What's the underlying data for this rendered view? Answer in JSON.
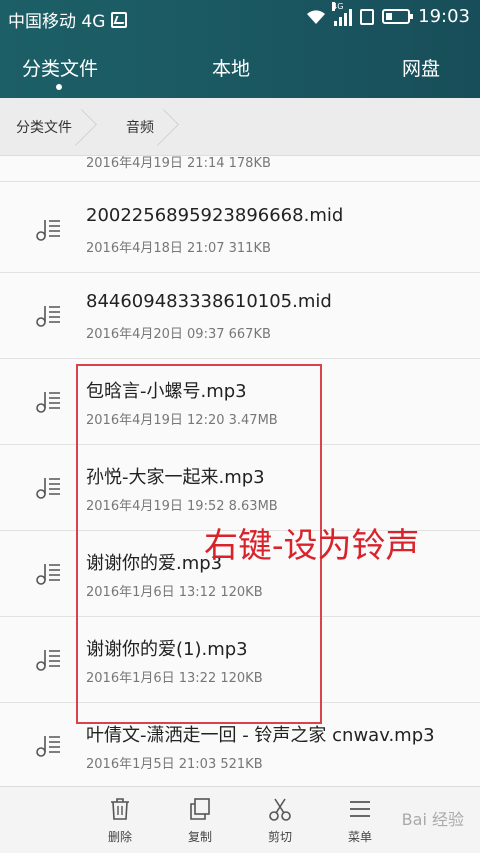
{
  "status": {
    "carrier": "中国移动 4G",
    "network_tag": "4G",
    "time": "19:03"
  },
  "tabs": [
    {
      "label": "分类文件",
      "active": true
    },
    {
      "label": "本地",
      "active": false
    },
    {
      "label": "网盘",
      "active": false
    }
  ],
  "breadcrumb": [
    "分类文件",
    "音频"
  ],
  "files": [
    {
      "name": "",
      "meta": "2016年4月19日 21:14 178KB"
    },
    {
      "name": "2002256895923896668.mid",
      "meta": "2016年4月18日 21:07 311KB"
    },
    {
      "name": "844609483338610105.mid",
      "meta": "2016年4月20日 09:37 667KB"
    },
    {
      "name": "包晗言-小螺号.mp3",
      "meta": "2016年4月19日 12:20 3.47MB"
    },
    {
      "name": "孙悦-大家一起来.mp3",
      "meta": "2016年4月19日 19:52 8.63MB"
    },
    {
      "name": "谢谢你的爱.mp3",
      "meta": "2016年1月6日 13:12 120KB"
    },
    {
      "name": "谢谢你的爱(1).mp3",
      "meta": "2016年1月6日 13:22 120KB"
    },
    {
      "name": "叶倩文-潇洒走一回 - 铃声之家 cnwav.mp3",
      "meta": "2016年1月5日 21:03 521KB"
    }
  ],
  "annotation": "右键-设为铃声",
  "toolbar": {
    "delete": "删除",
    "copy": "复制",
    "cut": "剪切",
    "menu": "菜单"
  },
  "watermark": "Bai 经验",
  "colors": {
    "header": "#1b5a63",
    "highlight": "#d9434b"
  }
}
